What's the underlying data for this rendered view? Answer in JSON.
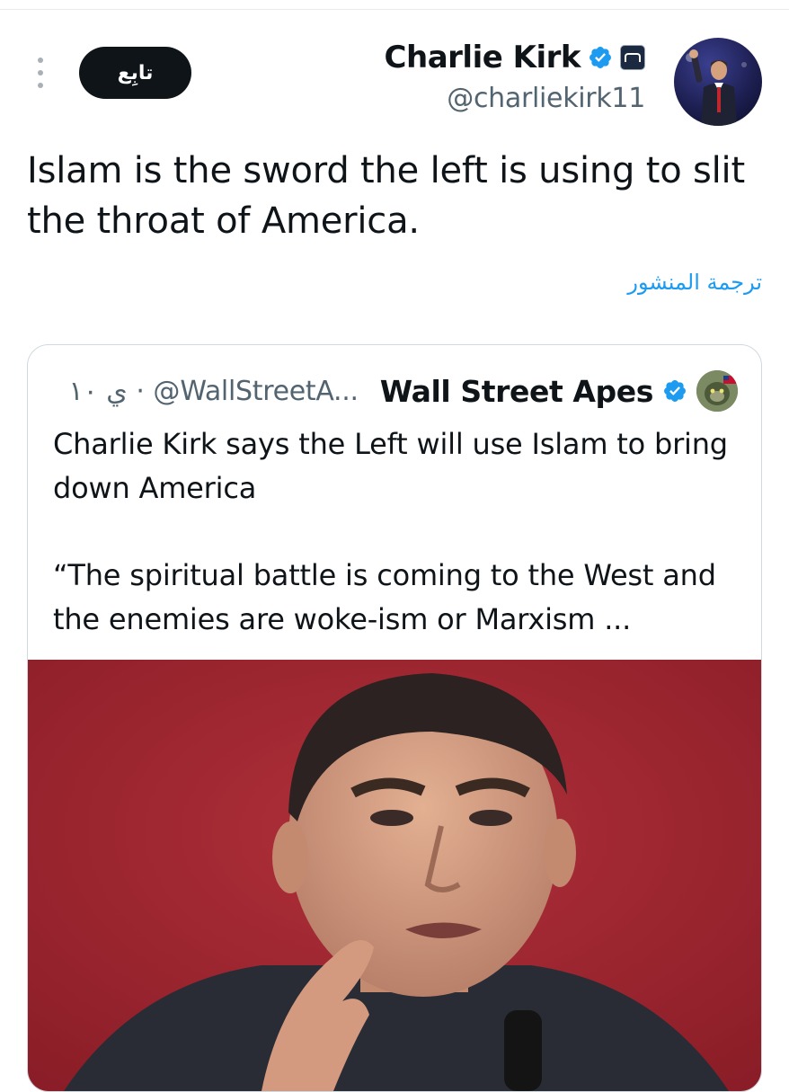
{
  "tweet": {
    "author_name": "Charlie Kirk",
    "author_handle": "@charliekirk11",
    "follow_label": "تابِع",
    "text": "Islam is the sword the left is using to slit the throat of America.",
    "translate_label": "ترجمة المنشور"
  },
  "quote": {
    "author_name": "Wall Street Apes",
    "meta": "ي ١٠ · @WallStreetA...",
    "paragraphs": [
      "Charlie Kirk says the Left will use Islam to bring down America",
      "“The spiritual battle is coming to the West and the enemies are woke-ism or Marxism ..."
    ]
  },
  "icons": {
    "more": "more-vertical-icon",
    "verified": "verified-badge-icon",
    "affiliation": "affiliation-badge-icon"
  },
  "colors": {
    "verified": "#1d9bf0",
    "link": "#1d9bf0",
    "muted": "#536471",
    "button_bg": "#0f1419"
  }
}
